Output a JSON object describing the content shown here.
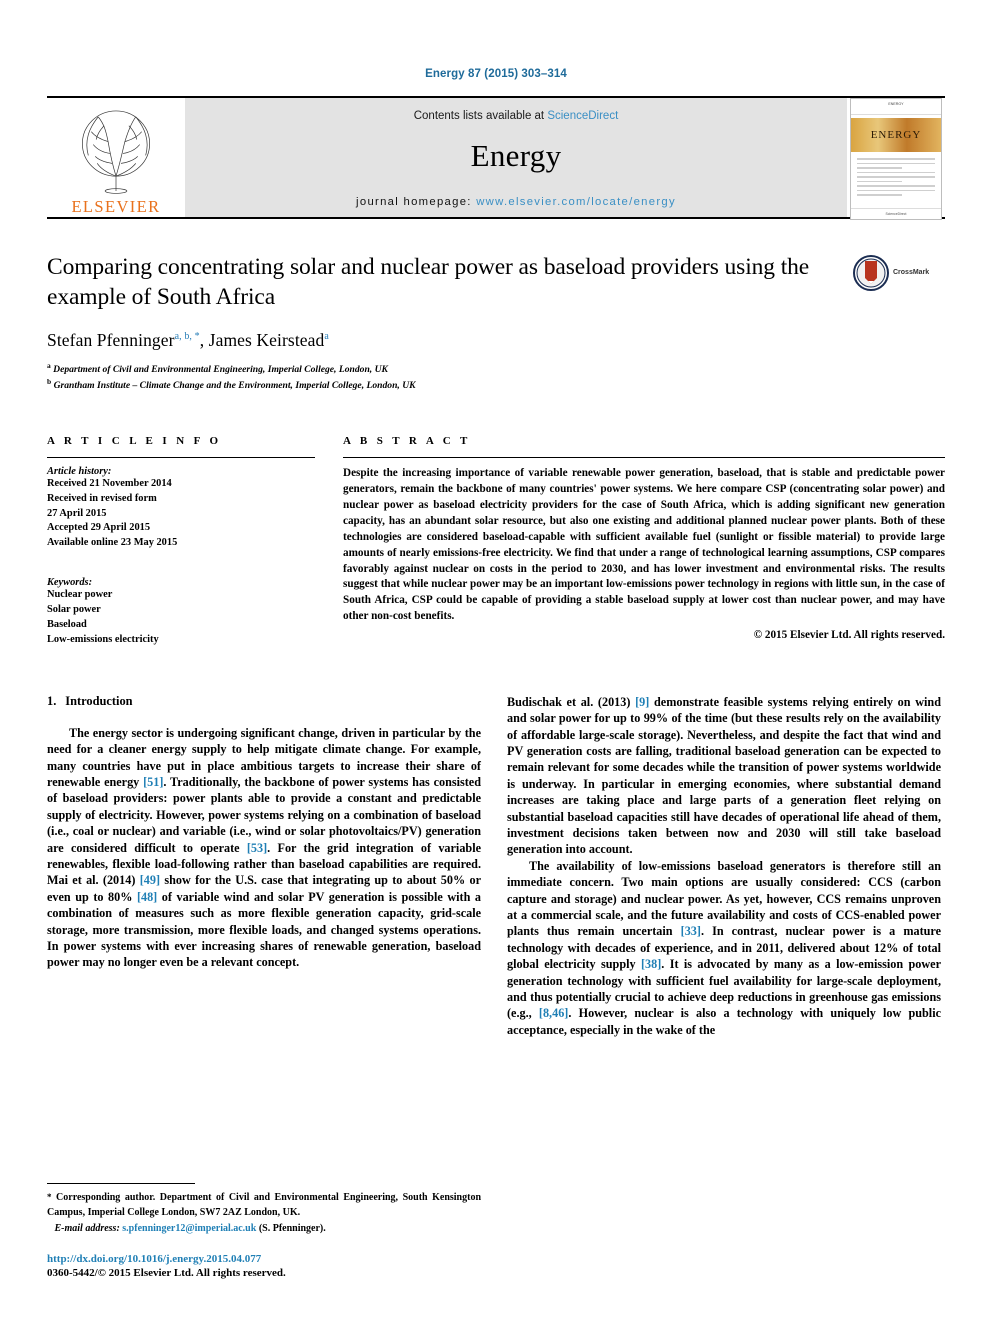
{
  "running_head": "Energy 87 (2015) 303–314",
  "masthead": {
    "publisher_name": "ELSEVIER",
    "contents_prefix": "Contents lists available at",
    "contents_link": "ScienceDirect",
    "journal_name": "Energy",
    "homepage_label": "journal homepage:",
    "homepage_url": "www.elsevier.com/locate/energy",
    "cover_top_text": "ENERGY",
    "cover_band_text": "ENERGY",
    "cover_foot_text": "ScienceDirect"
  },
  "title_block": {
    "title": "Comparing concentrating solar and nuclear power as baseload providers using the example of South Africa",
    "author_1": "Stefan Pfenninger",
    "author_1_marks": "a, b, *",
    "author_2": "James Keirstead",
    "author_2_marks": "a",
    "affiliation_a_mark": "a",
    "affiliation_a": "Department of Civil and Environmental Engineering, Imperial College, London, UK",
    "affiliation_b_mark": "b",
    "affiliation_b": "Grantham Institute – Climate Change and the Environment, Imperial College, London, UK",
    "crossmark_label": "CrossMark"
  },
  "article_info": {
    "heading": "A R T I C L E   I N F O",
    "history_title": "Article history:",
    "history": [
      "Received 21 November 2014",
      "Received in revised form",
      "27 April 2015",
      "Accepted 29 April 2015",
      "Available online 23 May 2015"
    ],
    "keywords_title": "Keywords:",
    "keywords": [
      "Nuclear power",
      "Solar power",
      "Baseload",
      "Low-emissions electricity"
    ]
  },
  "abstract": {
    "heading": "A B S T R A C T",
    "text": "Despite the increasing importance of variable renewable power generation, baseload, that is stable and predictable power generators, remain the backbone of many countries' power systems. We here compare CSP (concentrating solar power) and nuclear power as baseload electricity providers for the case of South Africa, which is adding significant new generation capacity, has an abundant solar resource, but also one existing and additional planned nuclear power plants. Both of these technologies are considered baseload-capable with sufficient available fuel (sunlight or fissible material) to provide large amounts of nearly emissions-free electricity. We find that under a range of technological learning assumptions, CSP compares favorably against nuclear on costs in the period to 2030, and has lower investment and environmental risks. The results suggest that while nuclear power may be an important low-emissions power technology in regions with little sun, in the case of South Africa, CSP could be capable of providing a stable baseload supply at lower cost than nuclear power, and may have other non-cost benefits.",
    "copyright": "© 2015 Elsevier Ltd. All rights reserved."
  },
  "body": {
    "section_number": "1.",
    "section_title": "Introduction",
    "left_paragraphs": [
      {
        "parts": [
          {
            "t": "The energy sector is undergoing significant change, driven in particular by the need for a cleaner energy supply to help mitigate climate change. For example, many countries have put in place ambitious targets to increase their share of renewable energy "
          },
          {
            "t": "[51]",
            "ref": true
          },
          {
            "t": ". Traditionally, the backbone of power systems has consisted of baseload providers: power plants able to provide a constant and predictable supply of electricity. However, power systems relying on a combination of baseload (i.e., coal or nuclear) and variable (i.e., wind or solar photovoltaics/PV) generation are considered difficult to operate "
          },
          {
            "t": "[53]",
            "ref": true
          },
          {
            "t": ". For the grid integration of variable renewables, flexible load-following rather than baseload capabilities are required. Mai et al. (2014) "
          },
          {
            "t": "[49]",
            "ref": true
          },
          {
            "t": " show for the U.S. case that integrating up to about 50% or even up to 80% "
          },
          {
            "t": "[48]",
            "ref": true
          },
          {
            "t": " of variable wind and solar PV generation is possible with a combination of measures such as more flexible generation capacity, grid-scale storage, more transmission, more flexible loads, and changed systems operations. In power systems with ever increasing shares of renewable generation, baseload power may no longer even be a relevant concept."
          }
        ]
      }
    ],
    "right_paragraphs": [
      {
        "parts": [
          {
            "t": "Budischak et al. (2013) "
          },
          {
            "t": "[9]",
            "ref": true
          },
          {
            "t": " demonstrate feasible systems relying entirely on wind and solar power for up to 99% of the time (but these results rely on the availability of affordable large-scale storage). Nevertheless, and despite the fact that wind and PV generation costs are falling, traditional baseload generation can be expected to remain relevant for some decades while the transition of power systems worldwide is underway. In particular in emerging economies, where substantial demand increases are taking place and large parts of a generation fleet relying on substantial baseload capacities still have decades of operational life ahead of them, investment decisions taken between now and 2030 will still take baseload generation into account."
          }
        ],
        "indent": false
      },
      {
        "parts": [
          {
            "t": "The availability of low-emissions baseload generators is therefore still an immediate concern. Two main options are usually considered: CCS (carbon capture and storage) and nuclear power. As yet, however, CCS remains unproven at a commercial scale, and the future availability and costs of CCS-enabled power plants thus remain uncertain "
          },
          {
            "t": "[33]",
            "ref": true
          },
          {
            "t": ". In contrast, nuclear power is a mature technology with decades of experience, and in 2011, delivered about 12% of total global electricity supply "
          },
          {
            "t": "[38]",
            "ref": true
          },
          {
            "t": ". It is advocated by many as a low-emission power generation technology with sufficient fuel availability for large-scale deployment, and thus potentially crucial to achieve deep reductions in greenhouse gas emissions (e.g., "
          },
          {
            "t": "[8,46]",
            "ref": true
          },
          {
            "t": ". However, nuclear is also a technology with uniquely low public acceptance, especially in the wake of the"
          }
        ],
        "indent": true
      }
    ]
  },
  "footnote": {
    "star": "*",
    "corresponding": "Corresponding author. Department of Civil and Environmental Engineering, South Kensington Campus, Imperial College London, SW7 2AZ London, UK.",
    "email_label": "E-mail address:",
    "email": "s.pfenninger12@imperial.ac.uk",
    "email_suffix": "(S. Pfenninger).",
    "doi": "http://dx.doi.org/10.1016/j.energy.2015.04.077",
    "issn": "0360-5442/© 2015 Elsevier Ltd. All rights reserved."
  },
  "colors": {
    "link_blue": "#1f7fb5",
    "elsevier_orange": "#e9711c",
    "band_gray": "#e3e3e3"
  }
}
